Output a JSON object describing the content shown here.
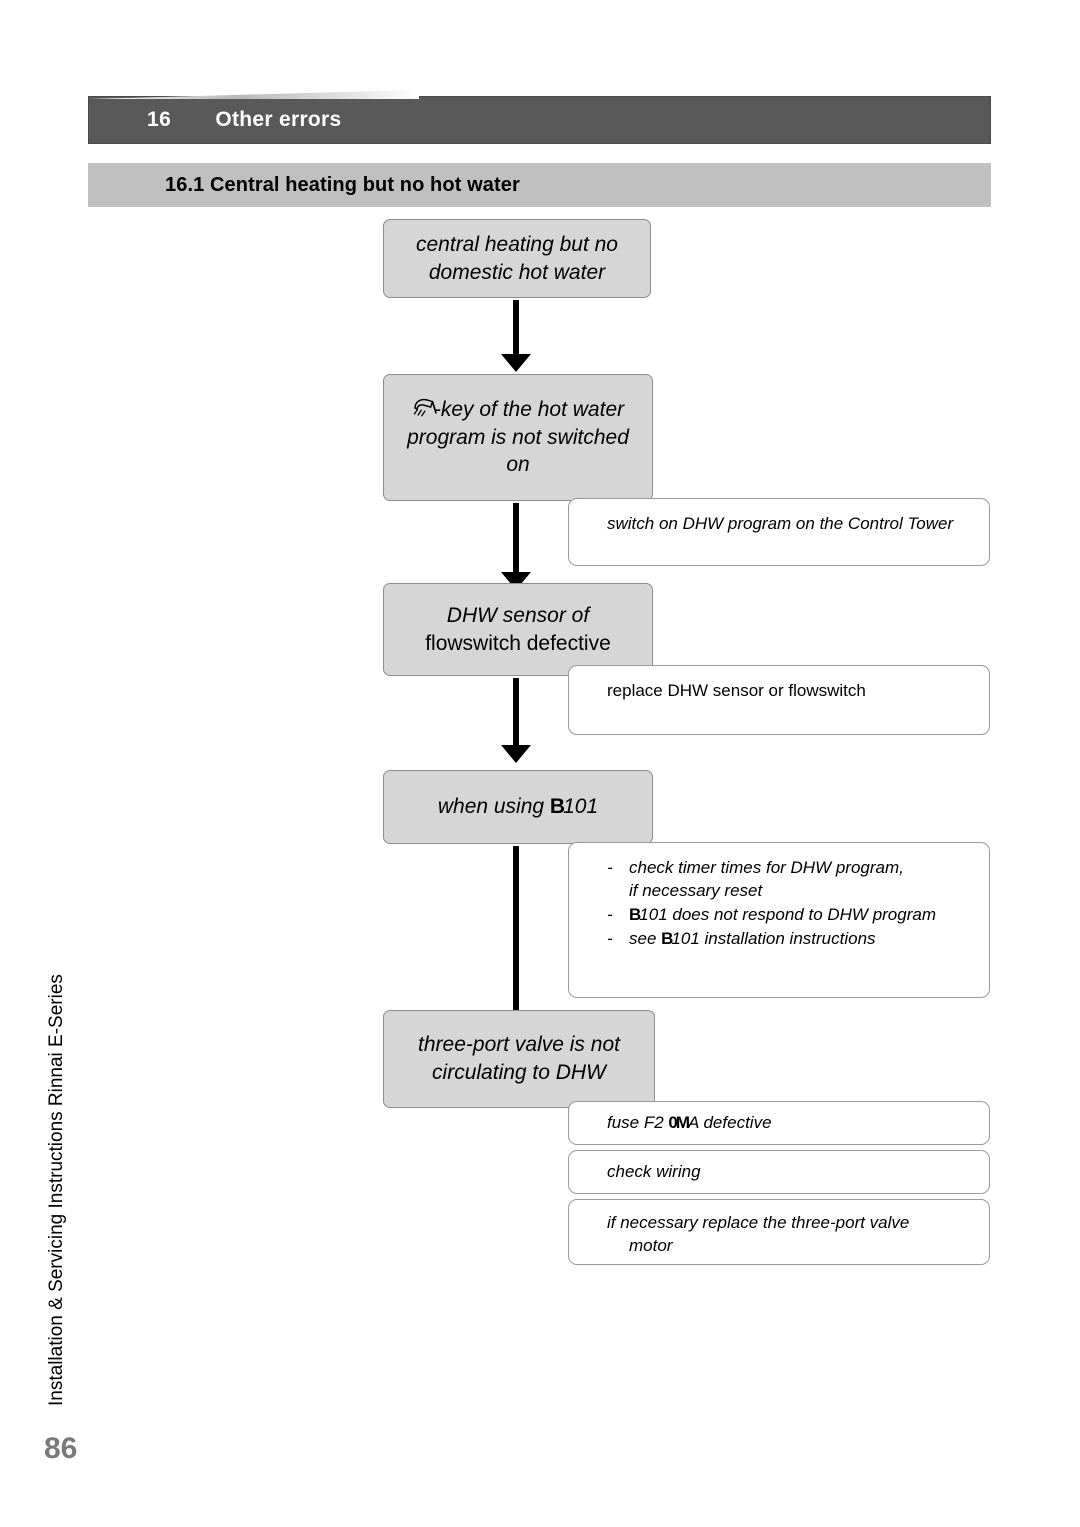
{
  "header": {
    "chapter_number": "16",
    "chapter_title": "Other errors",
    "section_title": "16.1 Central heating but no hot water",
    "bar_color": "#595959",
    "section_bar_color": "#c0c0c0"
  },
  "flow": {
    "node_fill": "#d6d6d6",
    "node_border": "#8e8e8e",
    "action_fill": "#ffffff",
    "action_border": "#9a9a9a",
    "nodes": [
      {
        "id": "problem",
        "text": "central heating but no domestic hot water"
      },
      {
        "id": "dhw-key-off",
        "icon": "shower-icon",
        "text": "-key of the hot water program is not switched on"
      },
      {
        "id": "dhw-sensor",
        "text_italic": "DHW sensor of",
        "text_plain": "flowswitch defective"
      },
      {
        "id": "b101",
        "text_before": "when using ",
        "symbol": "B",
        "text_after": "101"
      },
      {
        "id": "three-port-valve",
        "text": "three-port valve is not circulating to DHW"
      }
    ],
    "actions": [
      {
        "id": "switch-on-dhw",
        "text": "switch on DHW program on the Control Tower"
      },
      {
        "id": "replace-sensor",
        "text": "replace DHW sensor or flowswitch"
      },
      {
        "id": "b101-checks",
        "items": [
          {
            "dash": "-",
            "line1": "check timer times for DHW program,",
            "line2": "if necessary reset"
          },
          {
            "dash": "-",
            "symbol": "B",
            "line1": "101 does not respond to DHW program"
          },
          {
            "dash": "-",
            "prefix": "see ",
            "symbol": "B",
            "line1": "101 installation instructions"
          }
        ]
      },
      {
        "id": "fuse-f2",
        "text_before": "fuse F2 ",
        "symbol": "0M",
        "text_after": "A defective"
      },
      {
        "id": "check-wiring",
        "text": "check wiring"
      },
      {
        "id": "replace-valve-motor",
        "line1": "if necessary replace the three-port valve",
        "line2": "motor"
      }
    ]
  },
  "footer": {
    "side_text": "Installation & Servicing Instructions Rinnai E-Series",
    "page_number": "86",
    "page_number_color": "#7a7a7a"
  }
}
